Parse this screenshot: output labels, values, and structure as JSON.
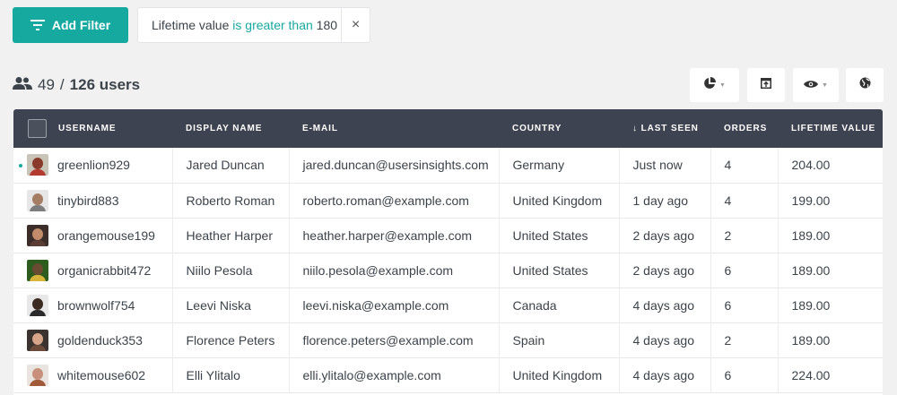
{
  "filter_bar": {
    "add_filter_label": "Add Filter",
    "active_filter": {
      "field": "Lifetime value",
      "operator": "is greater than",
      "value": "180",
      "remove_symbol": "×"
    }
  },
  "summary": {
    "shown": "49",
    "separator": "/",
    "total": "126 users"
  },
  "toolbar": {
    "icons": [
      "segment-pie-icon",
      "export-icon",
      "visibility-eye-icon",
      "map-globe-icon"
    ]
  },
  "colors": {
    "accent": "#16a9a0",
    "header_bg": "#3d4350",
    "page_bg": "#f1f1f1"
  },
  "table": {
    "columns": [
      "USERNAME",
      "DISPLAY NAME",
      "E-MAIL",
      "COUNTRY",
      "↓ LAST SEEN",
      "ORDERS",
      "LIFETIME VALUE"
    ],
    "rows": [
      {
        "username": "greenlion929",
        "display_name": "Jared Duncan",
        "email": "jared.duncan@usersinsights.com",
        "country": "Germany",
        "last_seen": "Just now",
        "orders": "4",
        "lifetime_value": "204.00",
        "online": true
      },
      {
        "username": "tinybird883",
        "display_name": "Roberto Roman",
        "email": "roberto.roman@example.com",
        "country": "United Kingdom",
        "last_seen": "1 day ago",
        "orders": "4",
        "lifetime_value": "199.00",
        "online": false
      },
      {
        "username": "orangemouse199",
        "display_name": "Heather Harper",
        "email": "heather.harper@example.com",
        "country": "United States",
        "last_seen": "2 days ago",
        "orders": "2",
        "lifetime_value": "189.00",
        "online": false
      },
      {
        "username": "organicrabbit472",
        "display_name": "Niilo Pesola",
        "email": "niilo.pesola@example.com",
        "country": "United States",
        "last_seen": "2 days ago",
        "orders": "6",
        "lifetime_value": "189.00",
        "online": false
      },
      {
        "username": "brownwolf754",
        "display_name": "Leevi Niska",
        "email": "leevi.niska@example.com",
        "country": "Canada",
        "last_seen": "4 days ago",
        "orders": "6",
        "lifetime_value": "189.00",
        "online": false
      },
      {
        "username": "goldenduck353",
        "display_name": "Florence Peters",
        "email": "florence.peters@example.com",
        "country": "Spain",
        "last_seen": "4 days ago",
        "orders": "2",
        "lifetime_value": "189.00",
        "online": false
      },
      {
        "username": "whitemouse602",
        "display_name": "Elli Ylitalo",
        "email": "elli.ylitalo@example.com",
        "country": "United Kingdom",
        "last_seen": "4 days ago",
        "orders": "6",
        "lifetime_value": "224.00",
        "online": false
      }
    ]
  }
}
